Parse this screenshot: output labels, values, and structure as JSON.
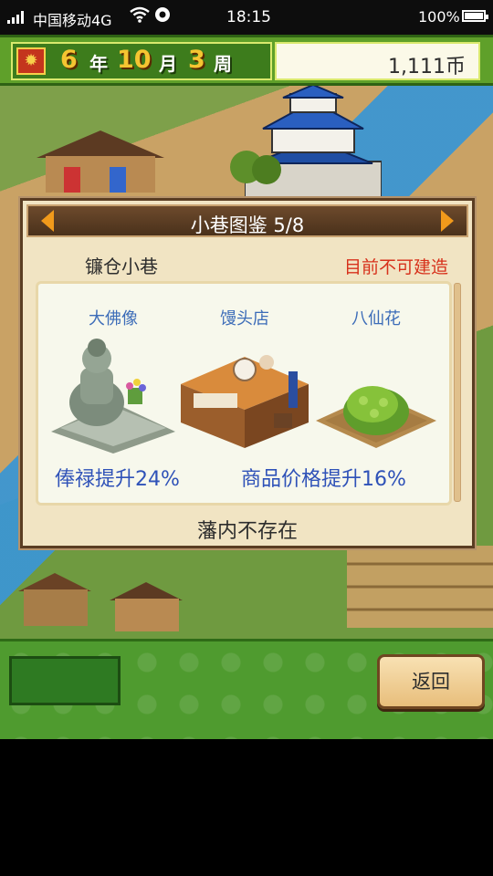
{
  "status_bar": {
    "carrier": "中国移动4G",
    "time": "18:15",
    "battery": "100%",
    "battery_level": 1.0
  },
  "top_bar": {
    "year": "6",
    "year_unit": "年",
    "month": "10",
    "month_unit": "月",
    "week": "3",
    "week_unit": "周",
    "coins": "1,111币"
  },
  "dialog": {
    "title": "小巷图鉴 5/8",
    "street_name": "镰仓小巷",
    "build_status": "目前不可建造",
    "items": [
      {
        "name": "大佛像",
        "icon": "great-buddha-statue"
      },
      {
        "name": "馒头店",
        "icon": "manju-shop"
      },
      {
        "name": "八仙花",
        "icon": "hydrangea-bush"
      }
    ],
    "effects": {
      "salary": "俸禄提升24%",
      "price": "商品价格提升16%"
    },
    "note": "藩内不存在"
  },
  "bottom_bar": {
    "back_label": "返回"
  },
  "colors": {
    "accent_orange": "#f19a1b",
    "status_red": "#d7311b",
    "effect_blue": "#2f52b8",
    "name_blue": "#3c6cb8",
    "bar_green": "#5fa02a"
  }
}
